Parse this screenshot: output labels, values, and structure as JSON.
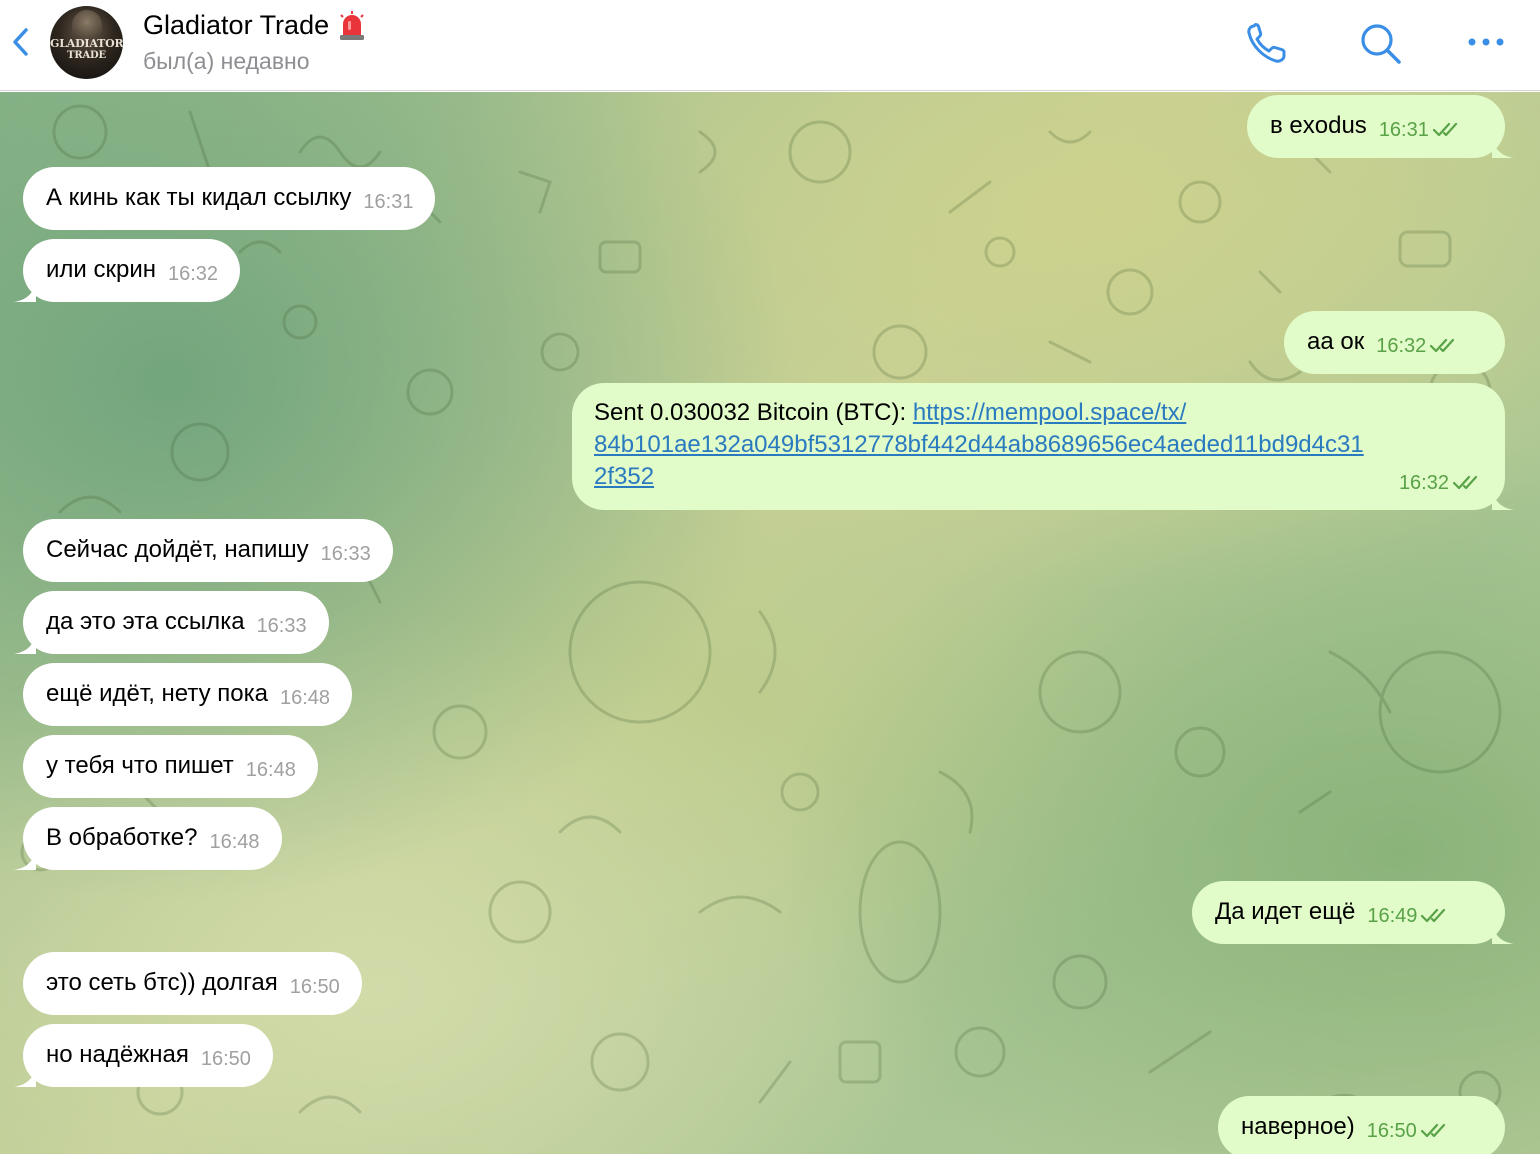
{
  "header": {
    "back_label": "Back",
    "title": "Gladiator Trade",
    "status": "был(а) недавно",
    "avatar_line1": "GLADIATOR",
    "avatar_line2": "TRADE",
    "accent": "#3a8ee6"
  },
  "messages": [
    {
      "side": "out",
      "text": "в exodus",
      "time": "16:31"
    },
    {
      "side": "in",
      "text": "А кинь как ты кидал ссылку",
      "time": "16:31"
    },
    {
      "side": "in",
      "text": "или скрин",
      "time": "16:32"
    },
    {
      "side": "out",
      "text": "аа ок",
      "time": "16:32"
    },
    {
      "side": "out",
      "text_prefix": "Sent 0.030032 Bitcoin (BTC): ",
      "link_line1": "https://mempool.space/tx/",
      "link_line2": "84b101ae132a049bf5312778bf442d44ab8689656ec4aeded11bd9d4c31",
      "link_line3": "2f352",
      "time": "16:32"
    },
    {
      "side": "in",
      "text": "Сейчас дойдёт, напишу",
      "time": "16:33"
    },
    {
      "side": "in",
      "text": "да это эта ссылка",
      "time": "16:33"
    },
    {
      "side": "in",
      "text": "ещё идёт, нету пока",
      "time": "16:48"
    },
    {
      "side": "in",
      "text": "у тебя что пишет",
      "time": "16:48"
    },
    {
      "side": "in",
      "text": "В обработке?",
      "time": "16:48"
    },
    {
      "side": "out",
      "text": "Да идет ещё",
      "time": "16:49"
    },
    {
      "side": "in",
      "text": "это сеть бтс)) долгая",
      "time": "16:50"
    },
    {
      "side": "in",
      "text": "но надёжная",
      "time": "16:50"
    },
    {
      "side": "out",
      "text": "наверное)",
      "time": "16:50"
    }
  ],
  "colors": {
    "incoming_bubble": "#ffffff",
    "outgoing_bubble": "#e1fbc9",
    "outgoing_time": "#59a248",
    "incoming_time": "#a0a0a0",
    "link": "#2a7ac0"
  }
}
